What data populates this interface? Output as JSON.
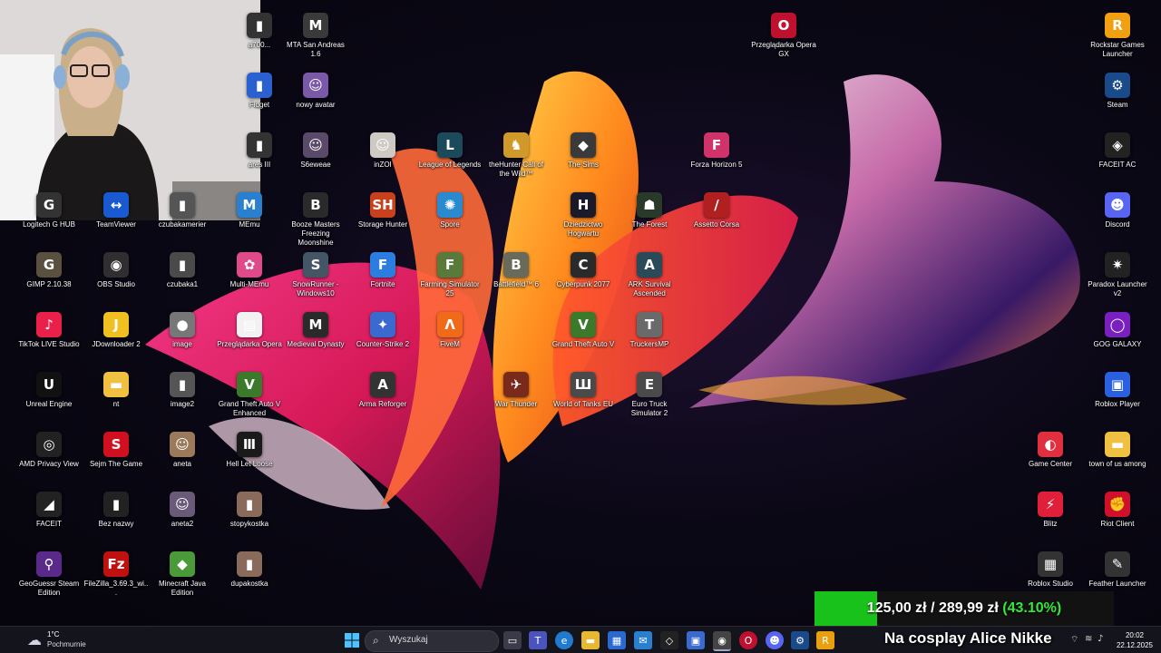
{
  "webcam": {
    "label": "streamer webcam"
  },
  "desktop_icons": [
    {
      "id": "mta",
      "label": "MTA San Andreas 1.6",
      "icon": "mta-icon",
      "color": "#3a3a3a",
      "glyph": "M"
    },
    {
      "id": "nowy-avatar",
      "label": "nowy avatar",
      "icon": "avatar-image-icon",
      "color": "#7a5aa8",
      "glyph": "☺"
    },
    {
      "id": "s6eweae",
      "label": "S6eweae",
      "icon": "image-icon",
      "color": "#5a4a6a",
      "glyph": "☺"
    },
    {
      "id": "booze",
      "label": "Booze Masters Freezing Moonshine",
      "icon": "booze-masters-icon",
      "color": "#2a2a2a",
      "glyph": "B"
    },
    {
      "id": "snowrunner",
      "label": "SnowRunner - Windows10",
      "icon": "snowrunner-icon",
      "color": "#445566",
      "glyph": "S"
    },
    {
      "id": "przegladarka-opera-doc",
      "label": "Przeglądarka Opera",
      "icon": "document-icon",
      "color": "#f2f2f2",
      "glyph": "▤"
    },
    {
      "id": "gta5-enh",
      "label": "Grand Theft Auto V Enhanced",
      "icon": "gta5-icon",
      "color": "#3b7a2a",
      "glyph": "V"
    },
    {
      "id": "hell-let-loose",
      "label": "Hell Let Loose",
      "icon": "hell-let-loose-icon",
      "color": "#1a1a1a",
      "glyph": "Ⅲ"
    },
    {
      "id": "stopykostka",
      "label": "stopykostka",
      "icon": "image-icon",
      "color": "#8a6a5a",
      "glyph": "▮"
    },
    {
      "id": "dupakostka",
      "label": "dupakostka",
      "icon": "image-icon",
      "color": "#8a6a5a",
      "glyph": "▮"
    },
    {
      "id": "inzoi",
      "label": "inZOI",
      "icon": "inzoi-icon",
      "color": "#cfc9c4",
      "glyph": "☺"
    },
    {
      "id": "storage-hunter",
      "label": "Storage Hunter",
      "icon": "storage-hunter-icon",
      "color": "#c8401e",
      "glyph": "SH"
    },
    {
      "id": "fortnite",
      "label": "Fortnite",
      "icon": "fortnite-icon",
      "color": "#2b7de0",
      "glyph": "F"
    },
    {
      "id": "medieval-dynasty",
      "label": "Medieval Dynasty",
      "icon": "medieval-dynasty-icon",
      "color": "#2a2a2a",
      "glyph": "M"
    },
    {
      "id": "counter-strike",
      "label": "Counter-Strike 2",
      "icon": "counter-strike-icon",
      "color": "#3a6ad0",
      "glyph": "✦"
    },
    {
      "id": "arma",
      "label": "Arma Reforger",
      "icon": "arma-icon",
      "color": "#333333",
      "glyph": "A"
    },
    {
      "id": "lol",
      "label": "League of Legends",
      "icon": "league-of-legends-icon",
      "color": "#1b4a5a",
      "glyph": "L"
    },
    {
      "id": "spore",
      "label": "Spore",
      "icon": "spore-icon",
      "color": "#2a8ad0",
      "glyph": "✺"
    },
    {
      "id": "farming",
      "label": "Farming Simulator 25",
      "icon": "farming-simulator-icon",
      "color": "#5a7a3a",
      "glyph": "F"
    },
    {
      "id": "fivem",
      "label": "FiveM",
      "icon": "fivem-icon",
      "color": "#f06a1a",
      "glyph": "Λ"
    },
    {
      "id": "thehunter",
      "label": "theHunter Call of the Wild™",
      "icon": "thehunter-icon",
      "color": "#d09a2a",
      "glyph": "♞"
    },
    {
      "id": "battlefield",
      "label": "Battlefield™ 6",
      "icon": "battlefield-icon",
      "color": "#6a6a5a",
      "glyph": "B"
    },
    {
      "id": "war-thunder",
      "label": "War Thunder",
      "icon": "war-thunder-icon",
      "color": "#7a2a1a",
      "glyph": "✈"
    },
    {
      "id": "the-sims",
      "label": "The Sims",
      "icon": "the-sims-icon",
      "color": "#3a3a3a",
      "glyph": "◆"
    },
    {
      "id": "dziedzictwo",
      "label": "Dziedzictwo Hogwartu",
      "icon": "hogwarts-legacy-icon",
      "color": "#1a1a2a",
      "glyph": "H"
    },
    {
      "id": "cyberpunk",
      "label": "Cyberpunk 2077",
      "icon": "cyberpunk-icon",
      "color": "#2a2a2a",
      "glyph": "C"
    },
    {
      "id": "gta5",
      "label": "Grand Theft Auto V",
      "icon": "gta5-icon",
      "color": "#3b7a2a",
      "glyph": "V"
    },
    {
      "id": "world-of-tanks",
      "label": "World of Tanks EU",
      "icon": "world-of-tanks-icon",
      "color": "#4a4a4a",
      "glyph": "Ш"
    },
    {
      "id": "the-forest",
      "label": "The Forest",
      "icon": "the-forest-icon",
      "color": "#2a3a2a",
      "glyph": "☗"
    },
    {
      "id": "ark",
      "label": "ARK Survival Ascended",
      "icon": "ark-icon",
      "color": "#2a4a5a",
      "glyph": "A"
    },
    {
      "id": "truckersmp",
      "label": "TruckersMP",
      "icon": "truckersmp-icon",
      "color": "#6a6a6a",
      "glyph": "T"
    },
    {
      "id": "euro-truck",
      "label": "Euro Truck Simulator 2",
      "icon": "euro-truck-icon",
      "color": "#4a4a4a",
      "glyph": "E"
    },
    {
      "id": "assetto",
      "label": "Assetto Corsa",
      "icon": "assetto-corsa-icon",
      "color": "#b02020",
      "glyph": "∕"
    },
    {
      "id": "forza",
      "label": "Forza Horizon 5",
      "icon": "forza-icon",
      "color": "#d0326a",
      "glyph": "F"
    },
    {
      "id": "opera-gx",
      "label": "Przeglądarka Opera GX",
      "icon": "opera-gx-icon",
      "color": "#c01030",
      "glyph": "O"
    },
    {
      "id": "logitech",
      "label": "Logitech G HUB",
      "icon": "logitech-icon",
      "color": "#333",
      "glyph": "G"
    },
    {
      "id": "teamviewer",
      "label": "TeamViewer",
      "icon": "teamviewer-icon",
      "color": "#1a5ad0",
      "glyph": "↔"
    },
    {
      "id": "czubakamerier",
      "label": "czubakamerier",
      "icon": "image-icon",
      "color": "#555",
      "glyph": "▮"
    },
    {
      "id": "memu",
      "label": "MEmu",
      "icon": "memu-icon",
      "color": "#2a80d0",
      "glyph": "M"
    },
    {
      "id": "gimp",
      "label": "GIMP 2.10.38",
      "icon": "gimp-icon",
      "color": "#5a5040",
      "glyph": "G"
    },
    {
      "id": "obs",
      "label": "OBS Studio",
      "icon": "obs-icon",
      "color": "#302e31",
      "glyph": "◉"
    },
    {
      "id": "czubaka1",
      "label": "czubaka1",
      "icon": "image-icon",
      "color": "#4a4a4a",
      "glyph": "▮"
    },
    {
      "id": "multi-memu",
      "label": "Multi-MEmu",
      "icon": "multi-memu-icon",
      "color": "#e04a8a",
      "glyph": "✿"
    },
    {
      "id": "tiktok",
      "label": "TikTok LIVE Studio",
      "icon": "tiktok-icon",
      "color": "#e8204a",
      "glyph": "♪"
    },
    {
      "id": "jdownloader",
      "label": "JDownloader 2",
      "icon": "jdownloader-icon",
      "color": "#f0c020",
      "glyph": "J"
    },
    {
      "id": "image",
      "label": "image",
      "icon": "image-icon",
      "color": "#777",
      "glyph": "●"
    },
    {
      "id": "unreal",
      "label": "Unreal Engine",
      "icon": "unreal-icon",
      "color": "#111",
      "glyph": "U"
    },
    {
      "id": "nt",
      "label": "nt",
      "icon": "folder-icon",
      "color": "#f0c040",
      "glyph": "▬"
    },
    {
      "id": "image2",
      "label": "image2",
      "icon": "image-icon",
      "color": "#555",
      "glyph": "▮"
    },
    {
      "id": "amd-privacy",
      "label": "AMD Privacy View",
      "icon": "amd-privacy-icon",
      "color": "#222",
      "glyph": "◎"
    },
    {
      "id": "sejm",
      "label": "Sejm The Game",
      "icon": "sejm-icon",
      "color": "#d01020",
      "glyph": "S"
    },
    {
      "id": "aneta",
      "label": "aneta",
      "icon": "image-icon",
      "color": "#9a7a5a",
      "glyph": "☺"
    },
    {
      "id": "faceit",
      "label": "FACEIT",
      "icon": "faceit-icon",
      "color": "#222",
      "glyph": "◢"
    },
    {
      "id": "bez-nazwy",
      "label": "Bez nazwy",
      "icon": "image-icon",
      "color": "#222",
      "glyph": "▮"
    },
    {
      "id": "aneta2",
      "label": "aneta2",
      "icon": "image-icon",
      "color": "#6a5a7a",
      "glyph": "☺"
    },
    {
      "id": "geoguessr",
      "label": "GeoGuessr Steam Edition",
      "icon": "geoguessr-icon",
      "color": "#5a2a8a",
      "glyph": "⚲"
    },
    {
      "id": "filezilla",
      "label": "FileZilla_3.69.3_wi...",
      "icon": "filezilla-icon",
      "color": "#c01010",
      "glyph": "Fz"
    },
    {
      "id": "minecraft",
      "label": "Minecraft Java Edition",
      "icon": "minecraft-icon",
      "color": "#4a9a3a",
      "glyph": "◆"
    },
    {
      "id": "rockstar",
      "label": "Rockstar Games Launcher",
      "icon": "rockstar-icon",
      "color": "#f0a010",
      "glyph": "R"
    },
    {
      "id": "steam",
      "label": "Steam",
      "icon": "steam-icon",
      "color": "#1a4a8a",
      "glyph": "⚙"
    },
    {
      "id": "faceit-ac",
      "label": "FACEIT AC",
      "icon": "faceit-ac-icon",
      "color": "#222",
      "glyph": "◈"
    },
    {
      "id": "discord",
      "label": "Discord",
      "icon": "discord-icon",
      "color": "#5865f2",
      "glyph": "☻"
    },
    {
      "id": "paradox",
      "label": "Paradox Launcher v2",
      "icon": "paradox-icon",
      "color": "#222",
      "glyph": "✷"
    },
    {
      "id": "gog",
      "label": "GOG GALAXY",
      "icon": "gog-icon",
      "color": "#7a20c0",
      "glyph": "◯"
    },
    {
      "id": "roblox-player",
      "label": "Roblox Player",
      "icon": "roblox-icon",
      "color": "#2a60e0",
      "glyph": "▣"
    },
    {
      "id": "game-center",
      "label": "Game Center",
      "icon": "game-center-icon",
      "color": "#e03040",
      "glyph": "◐"
    },
    {
      "id": "town-of-us",
      "label": "town of us among",
      "icon": "folder-icon",
      "color": "#f0c040",
      "glyph": "▬"
    },
    {
      "id": "blitz",
      "label": "Blitz",
      "icon": "blitz-icon",
      "color": "#e0203a",
      "glyph": "⚡"
    },
    {
      "id": "riot",
      "label": "Riot Client",
      "icon": "riot-icon",
      "color": "#d0102a",
      "glyph": "✊"
    },
    {
      "id": "roblox-studio",
      "label": "Roblox Studio",
      "icon": "roblox-studio-icon",
      "color": "#333",
      "glyph": "▦"
    },
    {
      "id": "feather",
      "label": "Feather Launcher",
      "icon": "feather-icon",
      "color": "#333",
      "glyph": "✎"
    },
    {
      "id": "fidget",
      "label": "Fidget",
      "icon": "fidget-icon",
      "color": "#2a60d0",
      "glyph": "▮"
    },
    {
      "id": "ares3",
      "label": "ares III",
      "icon": "ares-icon",
      "color": "#333",
      "glyph": "▮"
    },
    {
      "id": "a700",
      "label": "a700...",
      "icon": "image-icon",
      "color": "#333",
      "glyph": "▮"
    }
  ],
  "overlay": {
    "donation_text_amount": "125,00 zł",
    "donation_text_sep": "/",
    "donation_text_goal": "289,99 zł",
    "donation_percent_text": "(43.10%)",
    "donation_progress": 0.431,
    "ticker": "Na cosplay Alice Nikke"
  },
  "taskbar": {
    "weather_temp": "1°C",
    "weather_desc": "Pochmurnie",
    "search_placeholder": "Wyszukaj",
    "time": "20:02",
    "date": "22.12.2025"
  },
  "colors": {
    "taskbar_bg": "#16161e",
    "progress_fill": "#18c21a",
    "percent_text": "#35e83a"
  }
}
